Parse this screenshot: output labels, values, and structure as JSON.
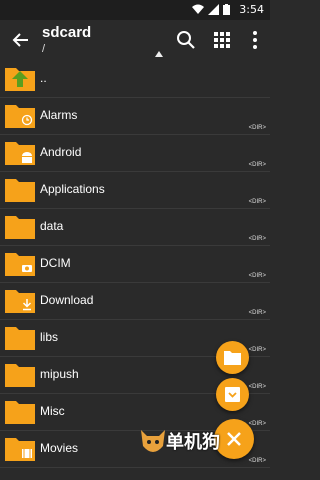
{
  "status_bar": {
    "time": "3:54"
  },
  "app_bar": {
    "title": "sdcard",
    "path": "/"
  },
  "colors": {
    "accent": "#f6a21a",
    "background": "#2a2a2a",
    "folder": "#f6a21a"
  },
  "files": [
    {
      "name": "..",
      "dir_label": "",
      "icon": "up-arrow-icon"
    },
    {
      "name": "Alarms",
      "dir_label": "<DIR>",
      "icon": "alarm-icon"
    },
    {
      "name": "Android",
      "dir_label": "<DIR>",
      "icon": "android-icon"
    },
    {
      "name": "Applications",
      "dir_label": "<DIR>",
      "icon": ""
    },
    {
      "name": "data",
      "dir_label": "<DIR>",
      "icon": ""
    },
    {
      "name": "DCIM",
      "dir_label": "<DIR>",
      "icon": "camera-icon"
    },
    {
      "name": "Download",
      "dir_label": "<DIR>",
      "icon": "download-icon"
    },
    {
      "name": "libs",
      "dir_label": "<DIR>",
      "icon": ""
    },
    {
      "name": "mipush",
      "dir_label": "<DIR>",
      "icon": ""
    },
    {
      "name": "Misc",
      "dir_label": "<DIR>",
      "icon": ""
    },
    {
      "name": "Movies",
      "dir_label": "<DIR>",
      "icon": "film-icon"
    }
  ],
  "watermark": {
    "text": "单机狗"
  }
}
